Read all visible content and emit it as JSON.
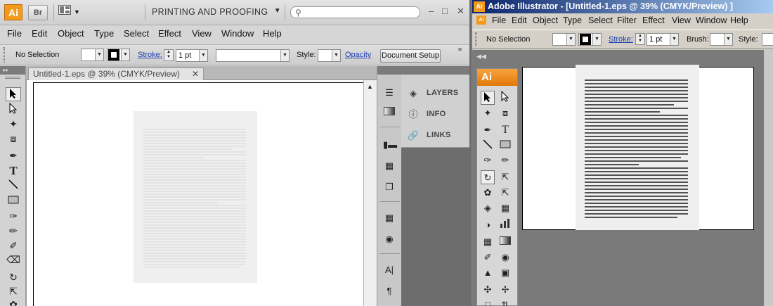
{
  "left_window": {
    "app_icon": "Ai",
    "bridge_icon": "Br",
    "workspace": "PRINTING AND PROOFING",
    "search": {
      "value": "",
      "placeholder": ""
    },
    "window_controls": [
      "minimize-icon",
      "restore-icon",
      "close-icon"
    ],
    "menu": [
      "File",
      "Edit",
      "Object",
      "Type",
      "Select",
      "Effect",
      "View",
      "Window",
      "Help"
    ],
    "control_bar": {
      "selection": "No Selection",
      "stroke_label": "Stroke:",
      "stroke_weight": "1 pt",
      "style_label": "Style:",
      "opacity_label": "Opacity",
      "document_setup": "Document Setup"
    },
    "doc_tab": "Untitled-1.eps @ 39% (CMYK/Preview)",
    "panels": [
      "LAYERS",
      "INFO",
      "LINKS"
    ],
    "tools": [
      "selection-tool-icon",
      "direct-selection-tool-icon",
      "magic-wand-tool-icon",
      "lasso-tool-icon",
      "pen-tool-icon",
      "type-tool-icon",
      "line-segment-tool-icon",
      "rectangle-tool-icon",
      "paintbrush-tool-icon",
      "pencil-tool-icon",
      "blob-brush-tool-icon",
      "eraser-tool-icon",
      "rotate-tool-icon",
      "scale-tool-icon"
    ]
  },
  "right_window": {
    "app_icon": "Ai",
    "title": "Adobe Illustrator - [Untitled-1.eps @ 39% (CMYK/Preview) ]",
    "menu": [
      "File",
      "Edit",
      "Object",
      "Type",
      "Select",
      "Filter",
      "Effect",
      "View",
      "Window",
      "Help"
    ],
    "control_bar": {
      "selection": "No Selection",
      "stroke_label": "Stroke:",
      "stroke_weight": "1 pt",
      "brush_label": "Brush:",
      "style_label": "Style:"
    },
    "toolbox_logo": "Ai"
  },
  "colors": {
    "ai_orange": "#f39a1e",
    "title_bar_blue": "#0a246a",
    "link_blue": "#1d3db0"
  }
}
